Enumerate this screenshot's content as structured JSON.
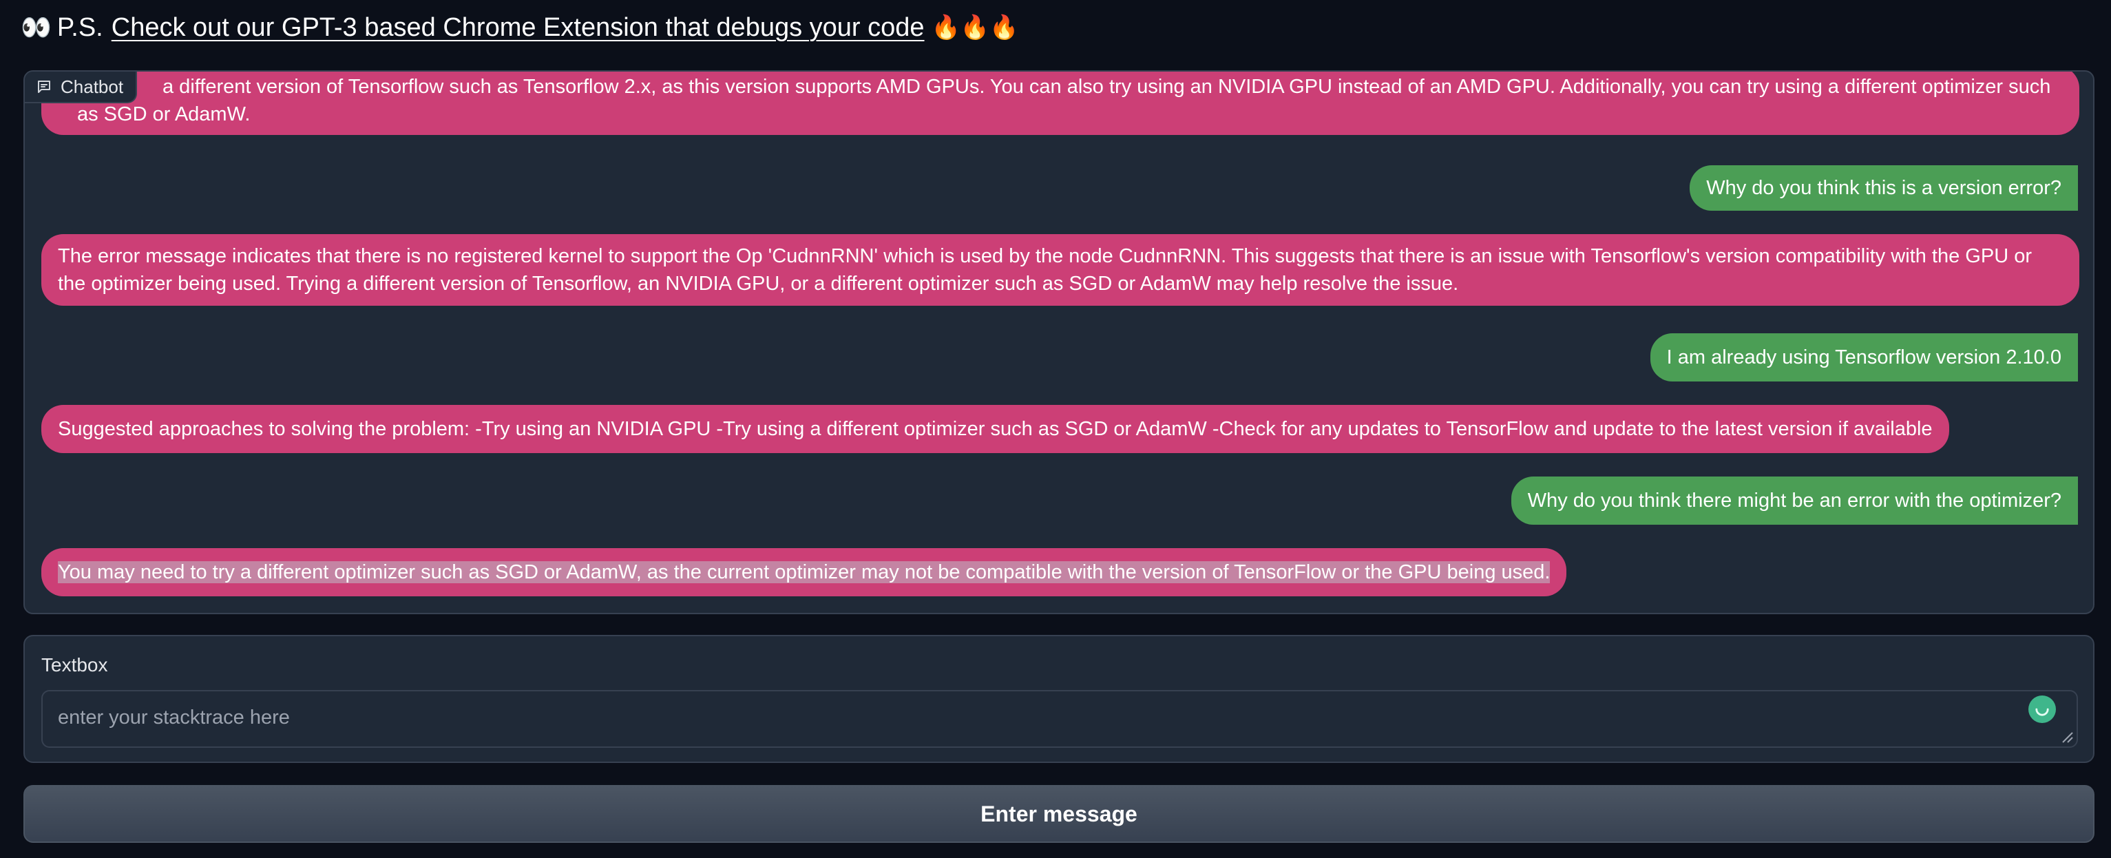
{
  "header": {
    "eyes_emoji": "👀",
    "prefix": "P.S.",
    "link_text": "Check out our GPT-3 based Chrome Extension that debugs your code",
    "fire_emojis": "🔥🔥🔥"
  },
  "chatbot": {
    "label": "Chatbot",
    "icon": "chat-bubble-icon",
    "messages": [
      {
        "role": "bot",
        "text": "a different version of Tensorflow such as Tensorflow 2.x, as this version supports AMD GPUs. You can also try using an NVIDIA GPU instead of an AMD GPU. Additionally, you can try using a different optimizer such as SGD or AdamW."
      },
      {
        "role": "user",
        "text": "Why do you think this is a version error?"
      },
      {
        "role": "bot",
        "text": "The error message indicates that there is no registered kernel to support the Op 'CudnnRNN' which is used by the node CudnnRNN. This suggests that there is an issue with Tensorflow's version compatibility with the GPU or the optimizer being used. Trying a different version of Tensorflow, an NVIDIA GPU, or a different optimizer such as SGD or AdamW may help resolve the issue."
      },
      {
        "role": "user",
        "text": "I am already using Tensorflow version 2.10.0"
      },
      {
        "role": "bot",
        "text": "Suggested approaches to solving the problem: -Try using an NVIDIA GPU -Try using a different optimizer such as SGD or AdamW -Check for any updates to TensorFlow and update to the latest version if available"
      },
      {
        "role": "user",
        "text": "Why do you think there might be an error with the optimizer?"
      },
      {
        "role": "bot",
        "text": "You may need to try a different optimizer such as SGD or AdamW, as the current optimizer may not be compatible with the version of TensorFlow or the GPU being used."
      }
    ]
  },
  "textbox": {
    "label": "Textbox",
    "value": "",
    "placeholder": "enter your stacktrace here",
    "status_icon": "loading-spinner-icon"
  },
  "submit": {
    "label": "Enter message"
  },
  "colors": {
    "page_bg": "#0b0f19",
    "panel_bg": "#1f2937",
    "bot_bubble": "#cc3f76",
    "user_bubble": "#4b9e55",
    "accent_spinner": "#3fb68b"
  }
}
